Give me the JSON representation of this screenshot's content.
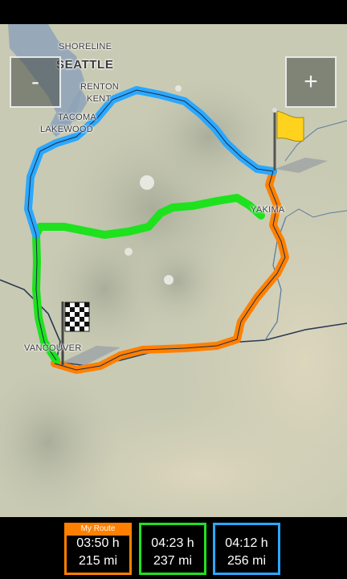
{
  "map": {
    "zoom_out_label": "-",
    "zoom_in_label": "+",
    "cities": {
      "shoreline": "SHORELINE",
      "seattle": "SEATTLE",
      "renton": "RENTON",
      "kent": "KENT",
      "tacoma": "TACOMA",
      "lakewood": "LAKEWOOD",
      "yakima": "YAKIMA",
      "vancouver": "VANCOUVER"
    },
    "colors": {
      "route_orange": "#ff8000",
      "route_green": "#1ee21e",
      "route_blue": "#2aa8ff"
    }
  },
  "routes": [
    {
      "tag": "My Route",
      "time": "03:50 h",
      "distance": "215 mi",
      "color": "#ff8000"
    },
    {
      "tag": "",
      "time": "04:23 h",
      "distance": "237 mi",
      "color": "#1ee21e"
    },
    {
      "tag": "",
      "time": "04:12 h",
      "distance": "256 mi",
      "color": "#2aa8ff"
    }
  ]
}
